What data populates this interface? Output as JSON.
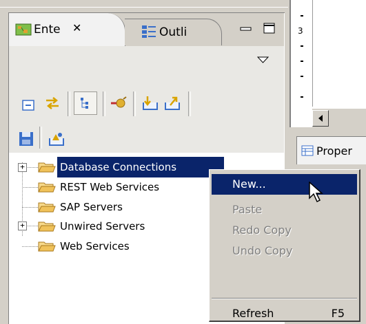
{
  "tabs": {
    "entity": {
      "label": "Ente",
      "close_glyph": "✕"
    },
    "outline": {
      "label": "Outli"
    }
  },
  "tree": {
    "items": [
      {
        "label": "Database Connections",
        "expandable": true,
        "selected": true
      },
      {
        "label": "REST Web Services",
        "expandable": false
      },
      {
        "label": "SAP Servers",
        "expandable": false
      },
      {
        "label": "Unwired Servers",
        "expandable": true
      },
      {
        "label": "Web Services",
        "expandable": false
      }
    ]
  },
  "context_menu": {
    "new": "New...",
    "paste": "Paste",
    "redo_copy": "Redo Copy",
    "undo_copy": "Undo Copy",
    "refresh": "Refresh",
    "refresh_shortcut": "F5"
  },
  "properties_tab": {
    "label": "Proper"
  },
  "ruler": {
    "mark": "3"
  },
  "colors": {
    "selection": "#0a246a",
    "folder": "#f0c25a",
    "panel_bg": "#d4d0c8"
  }
}
